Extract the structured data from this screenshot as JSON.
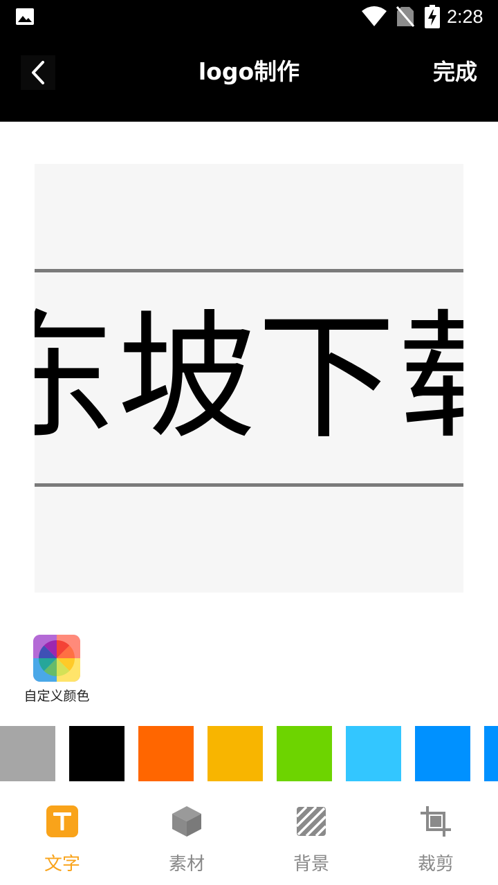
{
  "status": {
    "time": "2:28",
    "icons": [
      "gallery-icon",
      "wifi-icon",
      "no-sim-icon",
      "battery-charging-icon"
    ]
  },
  "header": {
    "title": "logo制作",
    "done_label": "完成",
    "back_icon": "chevron-left-icon"
  },
  "canvas": {
    "logo_text": "东坡下载",
    "background": "#f6f6f6",
    "text_color": "#000000"
  },
  "colors": {
    "custom_label": "自定义颜色",
    "swatches": [
      "#a6a6a6",
      "#000000",
      "#ff6600",
      "#f8b500",
      "#6dd400",
      "#33c6ff",
      "#0091ff",
      "#0091ff"
    ]
  },
  "tabs": [
    {
      "label": "文字",
      "icon": "text-icon",
      "active": true
    },
    {
      "label": "素材",
      "icon": "cube-icon",
      "active": false
    },
    {
      "label": "背景",
      "icon": "background-pattern-icon",
      "active": false
    },
    {
      "label": "裁剪",
      "icon": "crop-icon",
      "active": false
    }
  ],
  "accent": "#f9a31a"
}
